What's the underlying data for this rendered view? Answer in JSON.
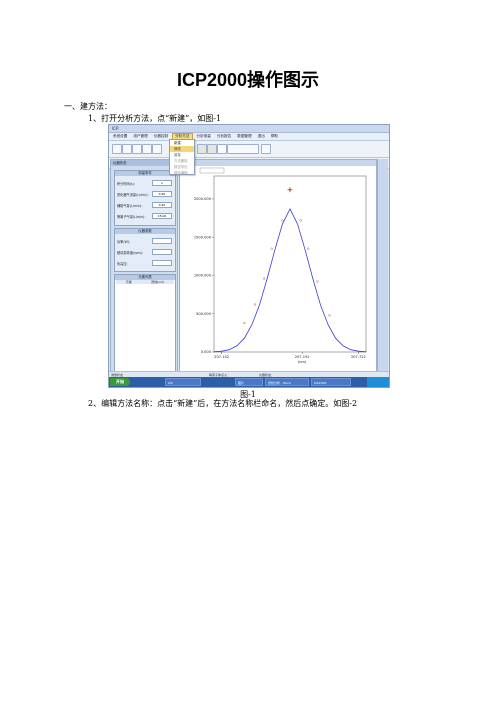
{
  "document": {
    "title": "ICP2000操作图示",
    "section": "一、建方法：",
    "step1": "1、打开分析方法，点“新建”，如图-1",
    "caption": "图-1",
    "step2": "2、编辑方法名称：点击“新建”后，在方法名称栏命名，然后点确定。如图-2"
  },
  "screenshot": {
    "menus": [
      "系统设置",
      "用户管理",
      "仪器控制",
      "分析方法",
      "分析测量",
      "分析报告",
      "数据管理",
      "退出",
      "帮助"
    ],
    "active_menu_index": 3,
    "dropdown_items": [
      "新建",
      "修改",
      "另存",
      "方法删除",
      "报告导出",
      "谱线编辑"
    ],
    "dropdown_highlight_index": 1,
    "left_pane_title": "仪器状态",
    "groups": [
      {
        "title": "测量条件",
        "rows": [
          {
            "label": "积分时间(s)：",
            "value": "1"
          },
          {
            "label": "雾化器气流量(L/min)：",
            "value": "0.90"
          },
          {
            "label": "辅助气量(L/min)：",
            "value": "0.40"
          },
          {
            "label": "等离子气量(L/min)：",
            "value": "15.00"
          }
        ]
      },
      {
        "title": "仪器参数",
        "rows": [
          {
            "label": "功率(W)：",
            "value": ""
          },
          {
            "label": "蠕动泵转速(rpm)：",
            "value": ""
          },
          {
            "label": "负高压：",
            "value": ""
          }
        ]
      }
    ],
    "table_group": {
      "title": "元素列表",
      "columns": [
        "元素",
        "谱线(nm)"
      ]
    },
    "chart_pane_title": "谱线图",
    "status_left": "测量状态",
    "status_mid": "等离子体点火：",
    "status_right": "仪器状态：",
    "taskbar": {
      "start": "开始",
      "tasks": [
        "ICP",
        "图片",
        "谱线分析 - Word",
        "ICP2000"
      ]
    }
  },
  "chart_data": {
    "type": "line",
    "xlabel": "(nm)",
    "x_ticks": [
      "207.142",
      "207.192",
      "207.722"
    ],
    "y_ticks": [
      "0.000",
      "500.000",
      "1000.000",
      "1500.000",
      "2000.000"
    ],
    "ylim": [
      0,
      2300
    ],
    "series": [
      {
        "curve": "gaussian-fit",
        "x": [
          0.0,
          0.05,
          0.1,
          0.15,
          0.2,
          0.25,
          0.3,
          0.35,
          0.4,
          0.45,
          0.5,
          0.55,
          0.6,
          0.65,
          0.7,
          0.75,
          0.8,
          0.85,
          0.9,
          0.95,
          1.0
        ],
        "y": [
          3,
          10,
          30,
          80,
          180,
          360,
          620,
          960,
          1330,
          1670,
          1870,
          1670,
          1330,
          960,
          620,
          360,
          180,
          80,
          30,
          10,
          3
        ]
      },
      {
        "curve": "measured-points",
        "x": [
          0.2,
          0.27,
          0.33,
          0.38,
          0.45,
          0.5,
          0.57,
          0.62,
          0.68,
          0.76
        ],
        "y": [
          380,
          620,
          960,
          1350,
          1720,
          2120,
          1720,
          1350,
          920,
          480
        ]
      }
    ],
    "peak_marker": {
      "x": 0.5,
      "y": 2120
    }
  }
}
